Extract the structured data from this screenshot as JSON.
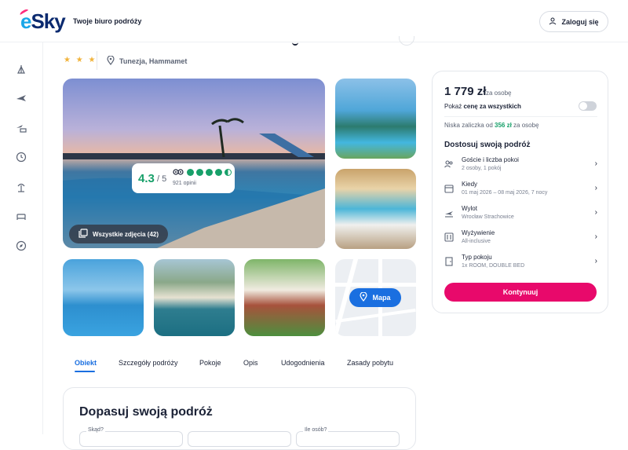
{
  "header": {
    "logo_text": "eSky",
    "tagline": "Twoje biuro podróży",
    "login_label": "Zaloguj się"
  },
  "sidebar": {
    "items": [
      {
        "icon": "beach-icon"
      },
      {
        "icon": "plane-icon"
      },
      {
        "icon": "plane-hotel-icon"
      },
      {
        "icon": "clock-icon"
      },
      {
        "icon": "palm-icon"
      },
      {
        "icon": "bed-icon"
      },
      {
        "icon": "compass-icon"
      }
    ]
  },
  "hotel": {
    "stars": "★ ★ ★",
    "location": "Tunezja, Hammamet"
  },
  "rating": {
    "score": "4.3",
    "max": "/ 5",
    "reviews": "921 opinii"
  },
  "gallery": {
    "all_photos_label": "Wszystkie zdjęcia (42)",
    "map_label": "Mapa"
  },
  "tabs": [
    "Obiekt",
    "Szczegóły podróży",
    "Pokoje",
    "Opis",
    "Udogodnienia",
    "Zasady pobytu"
  ],
  "customize": {
    "title": "Dopasuj swoją podróż",
    "field_labels": [
      "Skąd?",
      "",
      "Ile osób?"
    ]
  },
  "price_card": {
    "price": "1 779 zł",
    "per_person": "za osobę",
    "all_price_prefix": "Pokaż ",
    "all_price_bold": "cenę za wszystkich",
    "deposit_prefix": "Niska zaliczka od ",
    "deposit_amount": "356 zł",
    "deposit_suffix": " za osobę",
    "heading": "Dostosuj swoją podróż",
    "options": [
      {
        "title": "Goście i liczba pokoi",
        "sub": "2 osoby, 1 pokój",
        "icon": "users-icon"
      },
      {
        "title": "Kiedy",
        "sub": "01 maj 2026 – 08 maj 2026, 7 nocy",
        "icon": "calendar-icon"
      },
      {
        "title": "Wylot",
        "sub": "Wrocław Strachowice",
        "icon": "departure-icon"
      },
      {
        "title": "Wyżywienie",
        "sub": "All-inclusive",
        "icon": "food-icon"
      },
      {
        "title": "Typ pokoju",
        "sub": "1x ROOM, DOUBLE BED",
        "icon": "door-icon"
      }
    ],
    "cta": "Kontynuuj"
  },
  "colors": {
    "brand_navy": "#0b2a6f",
    "brand_blue": "#1aa7e8",
    "accent_pink": "#e8096b",
    "rating_green": "#18a06a",
    "link_blue": "#1a6fe0"
  }
}
